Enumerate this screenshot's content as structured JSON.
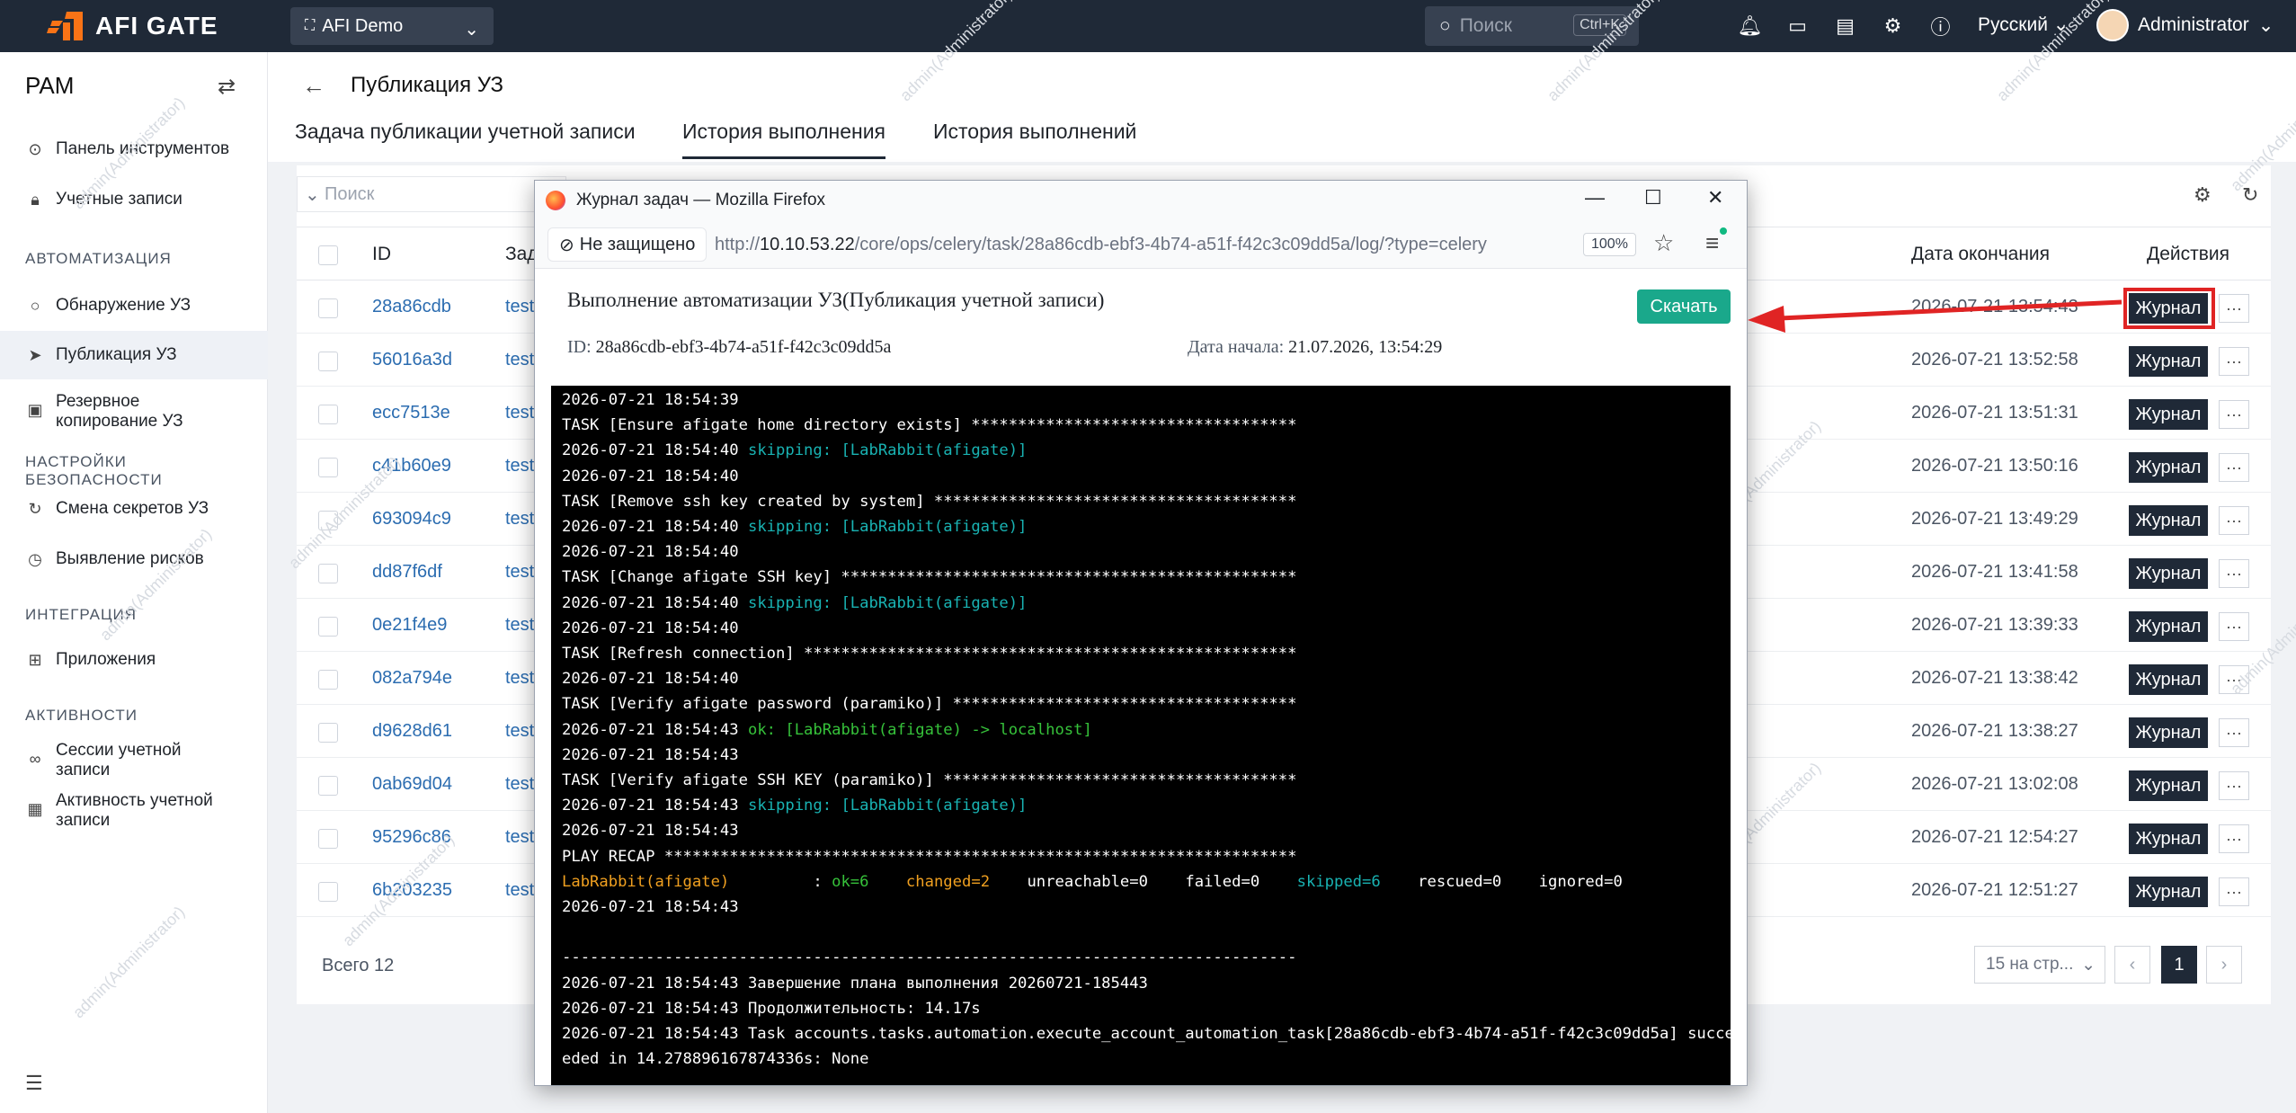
{
  "topbar": {
    "brand": "AFI GATE",
    "org": "AFI Demo",
    "search_placeholder": "Поиск",
    "search_shortcut": "Ctrl+K",
    "language": "Русский",
    "user": "Administrator"
  },
  "sidebar": {
    "title": "PAM",
    "items": [
      {
        "label": "Панель инструментов",
        "icon": "dashboard-icon"
      },
      {
        "label": "Учетные записи",
        "icon": "lock-icon"
      }
    ],
    "sec_automation": "АВТОМАТИЗАЦИЯ",
    "automation_items": [
      {
        "label": "Обнаружение УЗ",
        "icon": "search-icon"
      },
      {
        "label": "Публикация УЗ",
        "icon": "send-icon"
      },
      {
        "label": "Резервное копирование УЗ",
        "icon": "backup-icon"
      }
    ],
    "sec_security": "НАСТРОЙКИ БЕЗОПАСНОСТИ",
    "security_items": [
      {
        "label": "Смена секретов УЗ",
        "icon": "refresh-icon"
      },
      {
        "label": "Выявление рисков",
        "icon": "risk-icon"
      }
    ],
    "sec_integration": "ИНТЕГРАЦИЯ",
    "integration_items": [
      {
        "label": "Приложения",
        "icon": "apps-icon"
      }
    ],
    "sec_activity": "АКТИВНОСТИ",
    "activity_items": [
      {
        "label": "Сессии учетной записи",
        "icon": "link-icon"
      },
      {
        "label": "Активность учетной записи",
        "icon": "calendar-icon"
      }
    ]
  },
  "header": {
    "title": "Публикация УЗ",
    "tabs": [
      "Задача публикации учетной записи",
      "История выполнения",
      "История выполнений"
    ]
  },
  "list": {
    "filter_placeholder": "Поиск",
    "columns": {
      "id": "ID",
      "task": "Зад",
      "end": "Дата окончания",
      "actions": "Действия"
    },
    "rows": [
      {
        "id": "28a86cdb",
        "task": "test",
        "end": "2026-07-21 13:54:43"
      },
      {
        "id": "56016a3d",
        "task": "test",
        "end": "2026-07-21 13:52:58"
      },
      {
        "id": "ecc7513e",
        "task": "test",
        "end": "2026-07-21 13:51:31"
      },
      {
        "id": "c41b60e9",
        "task": "test",
        "end": "2026-07-21 13:50:16"
      },
      {
        "id": "693094c9",
        "task": "test",
        "end": "2026-07-21 13:49:29"
      },
      {
        "id": "dd87f6df",
        "task": "test",
        "end": "2026-07-21 13:41:58"
      },
      {
        "id": "0e21f4e9",
        "task": "test",
        "end": "2026-07-21 13:39:33"
      },
      {
        "id": "082a794e",
        "task": "test",
        "end": "2026-07-21 13:38:42"
      },
      {
        "id": "d9628d61",
        "task": "test",
        "end": "2026-07-21 13:38:27"
      },
      {
        "id": "0ab69d04",
        "task": "test",
        "end": "2026-07-21 13:02:08"
      },
      {
        "id": "95296c86",
        "task": "test",
        "end": "2026-07-21 12:54:27"
      },
      {
        "id": "6b203235",
        "task": "test",
        "end": "2026-07-21 12:51:27"
      }
    ],
    "journal_label": "Журнал",
    "more_label": "···",
    "total": "Всего 12",
    "page_size": "15 на стр...",
    "current_page": "1",
    "watermark": "admin(Administrator)"
  },
  "popup": {
    "window_title": "Журнал задач — Mozilla Firefox",
    "not_secure": "Не защищено",
    "url_prefix": "http://",
    "url_host": "10.10.53.22",
    "url_path": "/core/ops/celery/task/28a86cdb-ebf3-4b74-a51f-f42c3c09dd5a/log/?type=celery",
    "zoom": "100%",
    "title": "Выполнение автоматизации УЗ(Публикация учетной записи)",
    "download": "Скачать",
    "id_label": "ID:",
    "id_value": "28a86cdb-ebf3-4b74-a51f-f42c3c09dd5a",
    "start_label": "Дата начала:",
    "start_value": "21.07.2026, 13:54:29",
    "log": [
      {
        "t": "2026-07-21 18:54:39"
      },
      {
        "t": "TASK [Ensure afigate home directory exists] ***********************************"
      },
      {
        "t": "2026-07-21 18:54:40 ",
        "c": "skipping: [LabRabbit(afigate)]",
        "k": "cy"
      },
      {
        "t": "2026-07-21 18:54:40"
      },
      {
        "t": "TASK [Remove ssh key created by system] ***************************************"
      },
      {
        "t": "2026-07-21 18:54:40 ",
        "c": "skipping: [LabRabbit(afigate)]",
        "k": "cy"
      },
      {
        "t": "2026-07-21 18:54:40"
      },
      {
        "t": "TASK [Change afigate SSH key] *************************************************"
      },
      {
        "t": "2026-07-21 18:54:40 ",
        "c": "skipping: [LabRabbit(afigate)]",
        "k": "cy"
      },
      {
        "t": "2026-07-21 18:54:40"
      },
      {
        "t": "TASK [Refresh connection] *****************************************************"
      },
      {
        "t": "2026-07-21 18:54:40"
      },
      {
        "t": "TASK [Verify afigate password (paramiko)] *************************************"
      },
      {
        "t": "2026-07-21 18:54:43 ",
        "c": "ok: [LabRabbit(afigate) -> localhost]",
        "k": "gr"
      },
      {
        "t": "2026-07-21 18:54:43"
      },
      {
        "t": "TASK [Verify afigate SSH KEY (paramiko)] **************************************"
      },
      {
        "t": "2026-07-21 18:54:43 ",
        "c": "skipping: [LabRabbit(afigate)]",
        "k": "cy"
      },
      {
        "t": "2026-07-21 18:54:43"
      },
      {
        "t": "PLAY RECAP ********************************************************************"
      },
      {
        "recap": true
      },
      {
        "t": "2026-07-21 18:54:43"
      },
      {
        "t": ""
      },
      {
        "t": "-------------------------------------------------------------------------------"
      },
      {
        "t": "2026-07-21 18:54:43 Завершение плана выполнения 20260721-185443"
      },
      {
        "t": "2026-07-21 18:54:43 Продолжительность: 14.17s"
      },
      {
        "t": "2026-07-21 18:54:43 Task accounts.tasks.automation.execute_account_automation_task[28a86cdb-ebf3-4b74-a51f-f42c3c09dd5a] succe"
      },
      {
        "t": "eded in 14.278896167874336s: None"
      }
    ],
    "recap": {
      "host": "LabRabbit(afigate)",
      "sep": "         : ",
      "ok": "ok=6",
      "changed": "changed=2",
      "unreachable": "unreachable=0",
      "failed": "failed=0",
      "skipped": "skipped=6",
      "rescued": "rescued=0",
      "ignored": "ignored=0"
    }
  },
  "colors": {
    "topbar": "#1f2937",
    "accent": "#1aa88b",
    "link": "#2b6cb0",
    "highlight": "#e02424"
  }
}
